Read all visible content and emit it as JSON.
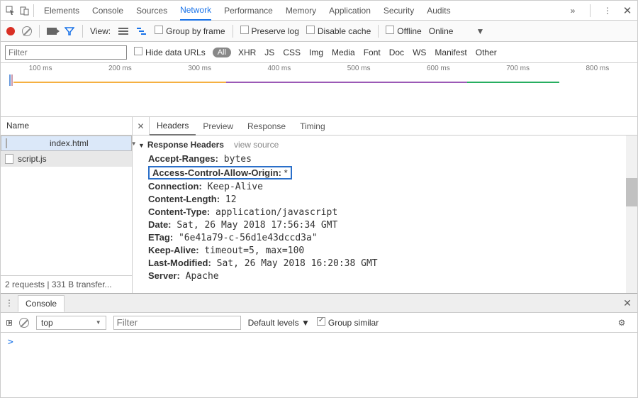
{
  "mainTabs": [
    "Elements",
    "Console",
    "Sources",
    "Network",
    "Performance",
    "Memory",
    "Application",
    "Security",
    "Audits"
  ],
  "mainActive": 3,
  "row2": {
    "view": "View:",
    "groupByFrame": "Group by frame",
    "preserveLog": "Preserve log",
    "disableCache": "Disable cache",
    "offline": "Offline",
    "online": "Online"
  },
  "row3": {
    "filterPlaceholder": "Filter",
    "hideData": "Hide data URLs",
    "all": "All",
    "types": [
      "XHR",
      "JS",
      "CSS",
      "Img",
      "Media",
      "Font",
      "Doc",
      "WS",
      "Manifest",
      "Other"
    ]
  },
  "timeline": {
    "marks": [
      "100 ms",
      "200 ms",
      "300 ms",
      "400 ms",
      "500 ms",
      "600 ms",
      "700 ms",
      "800 ms"
    ]
  },
  "left": {
    "name": "Name",
    "files": [
      "index.html",
      "script.js"
    ],
    "status": "2 requests  |  331 B transfer..."
  },
  "rtabs": [
    "Headers",
    "Preview",
    "Response",
    "Timing"
  ],
  "section": {
    "title": "Response Headers",
    "viewSource": "view source"
  },
  "headers": [
    {
      "k": "Accept-Ranges:",
      "v": " bytes"
    },
    {
      "k": "Access-Control-Allow-Origin:",
      "v": " *",
      "hl": true
    },
    {
      "k": "Connection:",
      "v": " Keep-Alive"
    },
    {
      "k": "Content-Length:",
      "v": " 12"
    },
    {
      "k": "Content-Type:",
      "v": " application/javascript"
    },
    {
      "k": "Date:",
      "v": " Sat, 26 May 2018 17:56:34 GMT"
    },
    {
      "k": "ETag:",
      "v": " \"6e41a79-c-56d1e43dccd3a\""
    },
    {
      "k": "Keep-Alive:",
      "v": " timeout=5, max=100"
    },
    {
      "k": "Last-Modified:",
      "v": " Sat, 26 May 2018 16:20:38 GMT"
    },
    {
      "k": "Server:",
      "v": " Apache"
    }
  ],
  "console": {
    "label": "Console",
    "context": "top",
    "filterPlaceholder": "Filter",
    "levels": "Default levels",
    "group": "Group similar",
    "prompt": ">"
  }
}
